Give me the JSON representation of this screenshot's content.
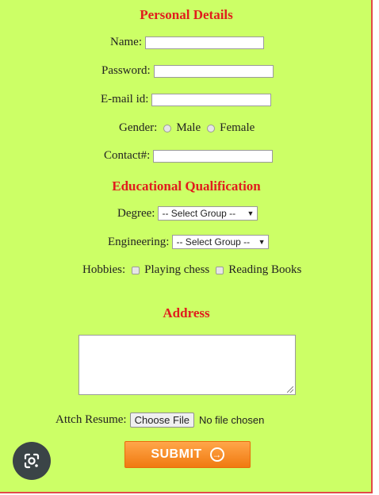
{
  "personal": {
    "heading": "Personal Details",
    "name_label": "Name:",
    "password_label": "Password:",
    "email_label": "E-mail id:",
    "gender_label": "Gender:",
    "gender_male": "Male",
    "gender_female": "Female",
    "contact_label": "Contact#:"
  },
  "education": {
    "heading": "Educational Qualification",
    "degree_label": "Degree:",
    "degree_selected": "-- Select Group --",
    "engineering_label": "Engineering:",
    "engineering_selected": "-- Select Group --",
    "hobbies_label": "Hobbies:",
    "hobby_1": "Playing chess",
    "hobby_2": "Reading Books"
  },
  "address": {
    "heading": "Address"
  },
  "resume": {
    "label": "Attch Resume:",
    "button": "Choose File",
    "status": "No file chosen"
  },
  "submit": {
    "label": "SUBMIT",
    "icon": "circle-arrow-right-icon"
  },
  "overlay": {
    "icon": "google-lens-icon"
  },
  "colors": {
    "background": "#ccff66",
    "heading": "#e11d1d",
    "submit": "#f7881f",
    "border": "#e14a4a"
  }
}
